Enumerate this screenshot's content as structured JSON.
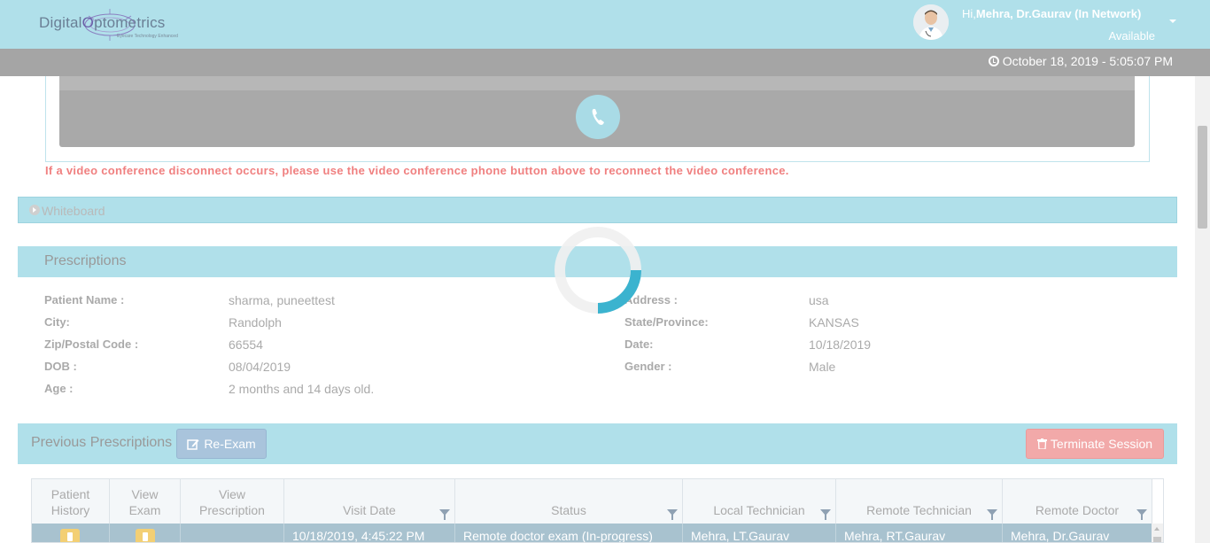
{
  "header": {
    "logo_text_1": "Digital",
    "logo_text_o": "O",
    "logo_text_2": "ptometrics",
    "logo_tagline": "Eyecare Technology Enhanced",
    "greeting_prefix": "Hi,",
    "user_name": "Mehra, Dr.Gaurav (In Network)",
    "status": "Available",
    "datetime": "October 18, 2019 - 5:05:07 PM"
  },
  "video": {
    "warning": "If a video conference disconnect occurs, please use the video conference phone button above to reconnect the video conference."
  },
  "whiteboard": {
    "label": "Whiteboard"
  },
  "prescriptions": {
    "title": "Prescriptions",
    "fields": {
      "patient_name_label": "Patient Name :",
      "patient_name": "sharma, puneettest",
      "city_label": "City:",
      "city": "Randolph",
      "zip_label": "Zip/Postal Code :",
      "zip": "66554",
      "dob_label": "DOB :",
      "dob": "08/04/2019",
      "age_label": "Age :",
      "age": "2 months and 14 days old.",
      "address_label": "Address :",
      "address": "usa",
      "state_label": "State/Province:",
      "state": "KANSAS",
      "date_label": "Date:",
      "date": "10/18/2019",
      "gender_label": "Gender :",
      "gender": "Male"
    }
  },
  "previous": {
    "title": "Previous Prescriptions",
    "reexam_label": "Re-Exam",
    "terminate_label": "Terminate Session",
    "columns": {
      "patient_history_1": "Patient",
      "patient_history_2": "History",
      "view_exam_1": "View",
      "view_exam_2": "Exam",
      "view_rx_1": "View",
      "view_rx_2": "Prescription",
      "visit_date": "Visit Date",
      "status": "Status",
      "local_tech": "Local Technician",
      "remote_tech": "Remote Technician",
      "remote_doctor": "Remote Doctor"
    },
    "rows": [
      {
        "visit_date": "10/18/2019, 4:45:22 PM",
        "status": "Remote doctor exam (In-progress)",
        "local_tech": "Mehra, LT.Gaurav",
        "remote_tech": "Mehra, RT.Gaurav",
        "remote_doctor": "Mehra, Dr.Gaurav"
      }
    ]
  },
  "colors": {
    "header_bg": "#b0e0ea",
    "datebar_bg": "#a5a5a5",
    "warning": "#f08080",
    "terminate": "#f2a9a9",
    "reexam": "#a9c4dc",
    "spinner": "#3bb3cf"
  }
}
